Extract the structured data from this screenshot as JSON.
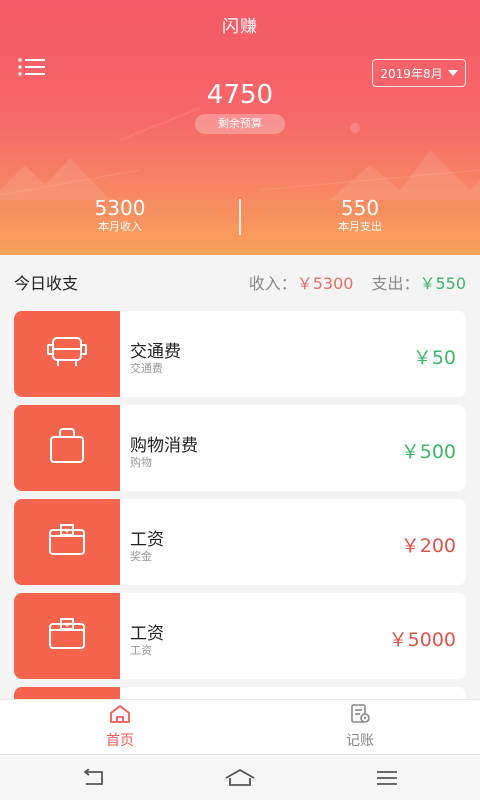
{
  "header": {
    "app_title": "闪赚",
    "month_selector": "2019年8月",
    "budget_value": "4750",
    "budget_label": "剩余预算",
    "income_value": "5300",
    "income_label": "本月收入",
    "expense_value": "550",
    "expense_label": "本月支出"
  },
  "summary": {
    "title": "今日收支",
    "income_label": "收入：",
    "income_amount": "￥5300",
    "expense_label": "支出：",
    "expense_amount": "￥550"
  },
  "transactions": [
    {
      "icon": "bus-icon",
      "category": "交通费",
      "subcategory": "交通费",
      "amount": "￥50",
      "type": "expense"
    },
    {
      "icon": "shopping-bag-icon",
      "category": "购物消费",
      "subcategory": "购物",
      "amount": "￥500",
      "type": "expense"
    },
    {
      "icon": "wallet-icon",
      "category": "工资",
      "subcategory": "奖金",
      "amount": "￥200",
      "type": "income"
    },
    {
      "icon": "wallet-icon",
      "category": "工资",
      "subcategory": "工资",
      "amount": "￥5000",
      "type": "income"
    }
  ],
  "tabbar": {
    "home_label": "首页",
    "ledger_label": "记账"
  },
  "colors": {
    "accent_red": "#f45a67",
    "tile_orange": "#f5644d",
    "income_red": "#e0534a",
    "expense_green": "#3cb56e"
  }
}
